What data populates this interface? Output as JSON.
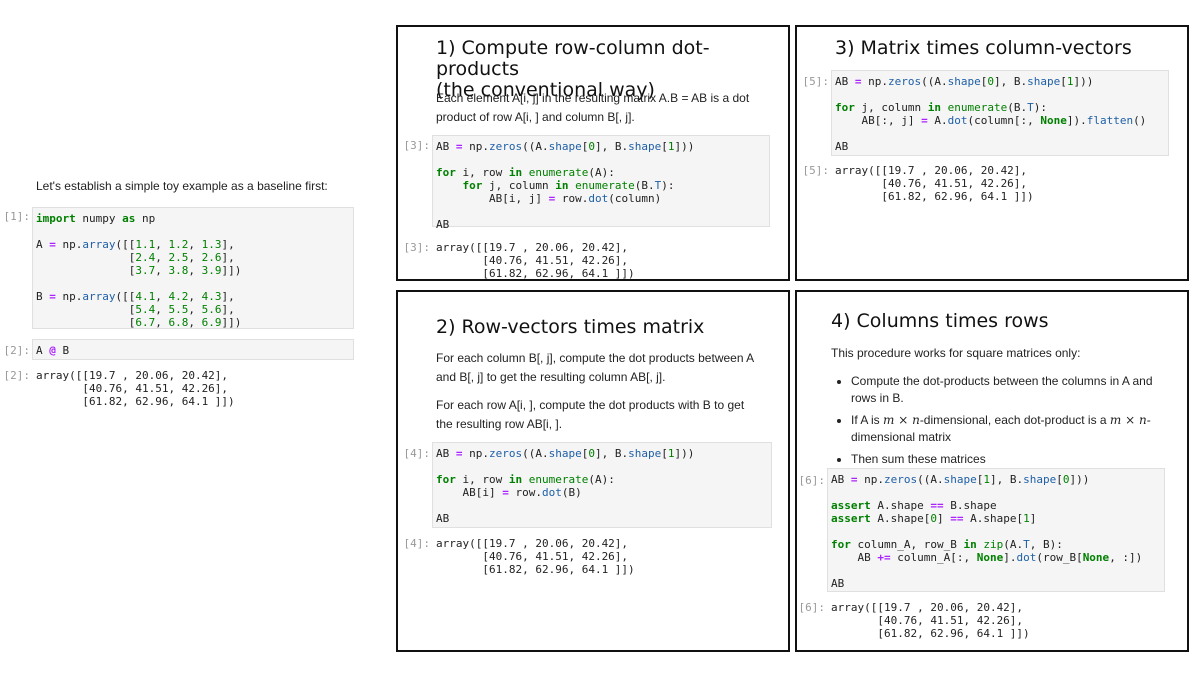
{
  "left": {
    "intro": "Let's establish a simple toy example as a baseline first:",
    "cell1": {
      "prompt": "[1]:"
    },
    "cell2": {
      "prompt": "[2]:",
      "code": "A @ B"
    },
    "out2": {
      "prompt": "[2]:",
      "text": "array([[19.7 , 20.06, 20.42],\n       [40.76, 41.51, 42.26],\n       [61.82, 62.96, 64.1 ]])"
    }
  },
  "panel1": {
    "title_line1": "1) Compute row-column dot-products",
    "title_line2": "(the conventional way)",
    "desc": "Each element A[i, j] in the resulting matrix A.B = AB is a dot product of row A[i, ] and column B[, j].",
    "in_prompt": "[3]:",
    "out_prompt": "[3]:",
    "output": "array([[19.7 , 20.06, 20.42],\n       [40.76, 41.51, 42.26],\n       [61.82, 62.96, 64.1 ]])"
  },
  "panel2": {
    "title": "2) Row-vectors times matrix",
    "desc1": "For each column B[, j], compute the dot products between A and B[, j] to get the resulting column AB[, j].",
    "desc2": "For each row A[i, ], compute the dot products with B to get the resulting row AB[i, ].",
    "in_prompt": "[4]:",
    "out_prompt": "[4]:",
    "output": "array([[19.7 , 20.06, 20.42],\n       [40.76, 41.51, 42.26],\n       [61.82, 62.96, 64.1 ]])"
  },
  "panel3": {
    "title": "3) Matrix times column-vectors",
    "in_prompt": "[5]:",
    "out_prompt": "[5]:",
    "output": "array([[19.7 , 20.06, 20.42],\n       [40.76, 41.51, 42.26],\n       [61.82, 62.96, 64.1 ]])"
  },
  "panel4": {
    "title": "4) Columns times rows",
    "desc": "This procedure works for square matrices only:",
    "bullet1": "Compute the dot-products between the columns in A and rows in B.",
    "bullet2_a": "If A is ",
    "bullet2_math": "m × n",
    "bullet2_b": "-dimensional, each dot-product is a ",
    "bullet2_math2": "m × n",
    "bullet2_c": "-dimensional matrix",
    "bullet3": "Then sum these matrices",
    "in_prompt": "[6]:",
    "out_prompt": "[6]:",
    "output": "array([[19.7 , 20.06, 20.42],\n       [40.76, 41.51, 42.26],\n       [61.82, 62.96, 64.1 ]])"
  },
  "colors": {
    "keyword": "#008000",
    "operator": "#aa22ff",
    "function": "#1f5fa6",
    "prompt": "#999999",
    "cell_bg": "#f5f5f5"
  }
}
